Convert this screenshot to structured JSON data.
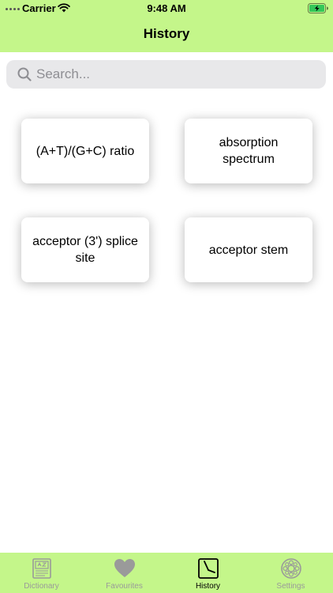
{
  "status_bar": {
    "carrier": "Carrier",
    "time": "9:48 AM",
    "wifi_icon": "wifi-icon",
    "battery_icon": "battery-charging-icon"
  },
  "header": {
    "title": "History",
    "background_color": "#c4f68a"
  },
  "search": {
    "placeholder": "Search...",
    "value": "",
    "icon": "search-icon"
  },
  "history_items": [
    {
      "label": "(A+T)/(G+C) ratio"
    },
    {
      "label": "absorption spectrum"
    },
    {
      "label": "acceptor (3') splice site"
    },
    {
      "label": "acceptor stem"
    }
  ],
  "tab_bar": {
    "background_color": "#c4f68a",
    "tabs": [
      {
        "label": "Dictionary",
        "icon": "dictionary-icon",
        "active": false
      },
      {
        "label": "Favourites",
        "icon": "heart-icon",
        "active": false
      },
      {
        "label": "History",
        "icon": "history-clock-icon",
        "active": true
      },
      {
        "label": "Settings",
        "icon": "settings-icon",
        "active": false
      }
    ]
  }
}
